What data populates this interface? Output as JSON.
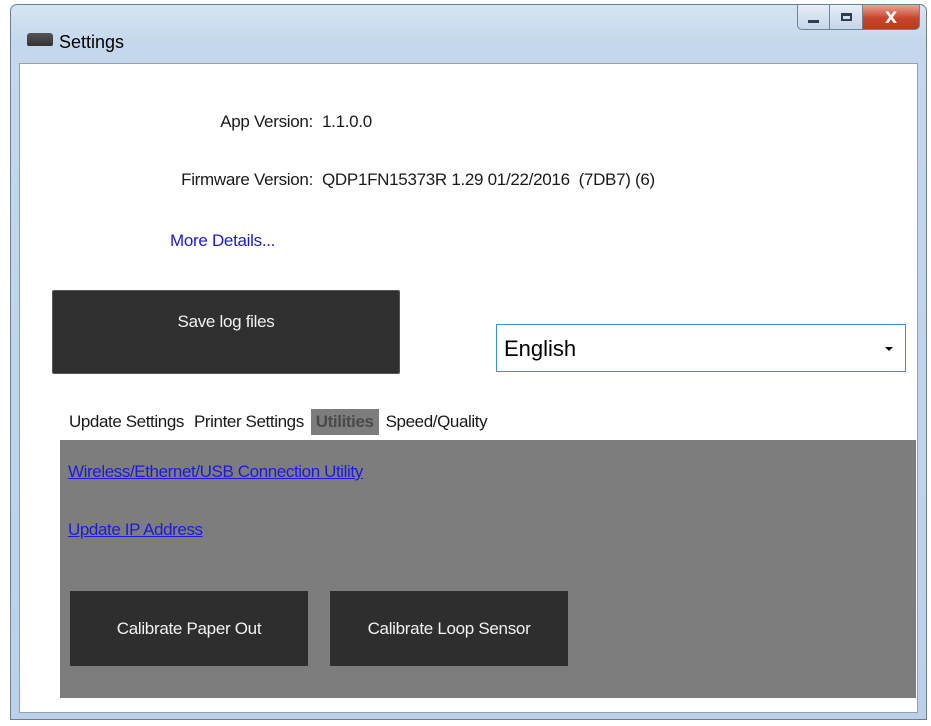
{
  "window": {
    "title": "Settings"
  },
  "info": {
    "app_version_label": "App Version:",
    "app_version_value": "1.1.0.0",
    "firmware_version_label": "Firmware Version:",
    "firmware_version_value": "QDP1FN15373R 1.29 01/22/2016  (7DB7) (6)",
    "more_details_link": "More Details..."
  },
  "actions": {
    "save_log_files": "Save log files"
  },
  "language": {
    "selected": "English"
  },
  "tabs": [
    {
      "label": "Update Settings",
      "active": false
    },
    {
      "label": "Printer Settings",
      "active": false
    },
    {
      "label": "Utilities",
      "active": true
    },
    {
      "label": "Speed/Quality",
      "active": false
    }
  ],
  "utilities": {
    "connection_utility_link": "Wireless/Ethernet/USB Connection Utility",
    "update_ip_link": "Update IP Address",
    "calibrate_paper_out": "Calibrate Paper Out",
    "calibrate_loop_sensor": "Calibrate Loop Sensor"
  },
  "caption_buttons": {
    "close_glyph": "X"
  },
  "colors": {
    "panel_background": "#7d7d7d",
    "button_dark": "#303030",
    "link": "#1b1be0",
    "select_border": "#3b8fd9"
  }
}
